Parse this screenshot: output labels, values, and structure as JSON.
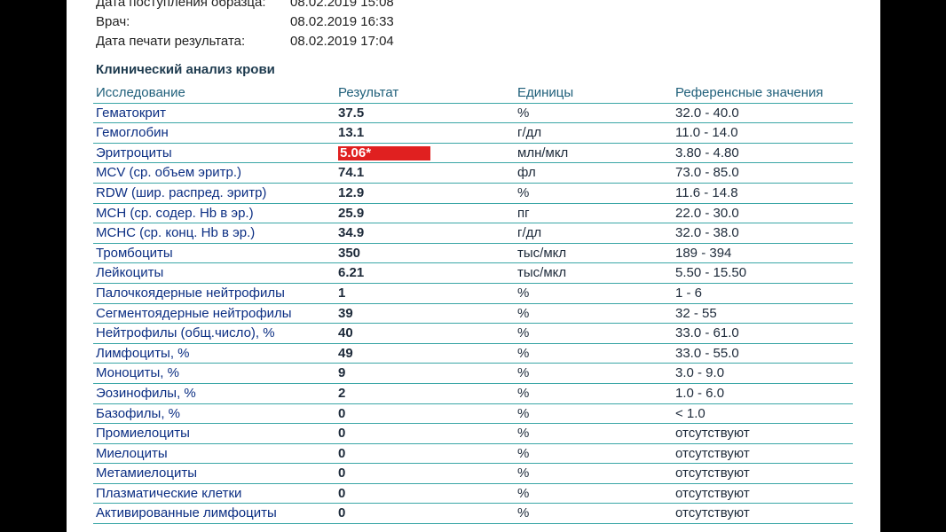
{
  "meta": {
    "rows": [
      {
        "label": "Дата поступления образца:",
        "value": "08.02.2019 15:08"
      },
      {
        "label": "Врач:",
        "value": "08.02.2019 16:33"
      },
      {
        "label": "Дата печати результата:",
        "value": "08.02.2019 17:04"
      }
    ]
  },
  "section_title": "Клинический анализ крови",
  "table": {
    "headers": {
      "name": "Исследование",
      "result": "Результат",
      "unit": "Единицы",
      "ref": "Референсные значения"
    },
    "rows": [
      {
        "name": "Гематокрит",
        "result": "37.5",
        "unit": "%",
        "ref": "32.0 - 40.0"
      },
      {
        "name": "Гемоглобин",
        "result": "13.1",
        "unit": "г/дл",
        "ref": "11.0 - 14.0"
      },
      {
        "name": "Эритроциты",
        "result": "5.06*",
        "unit": "млн/мкл",
        "ref": "3.80 - 4.80",
        "flag": true
      },
      {
        "name": "MCV (ср. объем эритр.)",
        "result": "74.1",
        "unit": "фл",
        "ref": "73.0 - 85.0"
      },
      {
        "name": "RDW (шир. распред. эритр)",
        "result": "12.9",
        "unit": "%",
        "ref": "11.6 - 14.8"
      },
      {
        "name": "MCH (ср. содер. Hb в эр.)",
        "result": "25.9",
        "unit": "пг",
        "ref": "22.0 - 30.0"
      },
      {
        "name": "MCHC (ср. конц. Hb в эр.)",
        "result": "34.9",
        "unit": "г/дл",
        "ref": "32.0 - 38.0"
      },
      {
        "name": "Тромбоциты",
        "result": "350",
        "unit": "тыс/мкл",
        "ref": "189 - 394"
      },
      {
        "name": "Лейкоциты",
        "result": "6.21",
        "unit": "тыс/мкл",
        "ref": "5.50 - 15.50"
      },
      {
        "name": "Палочкоядерные нейтрофилы",
        "result": "1",
        "unit": "%",
        "ref": "1 - 6"
      },
      {
        "name": "Сегментоядерные нейтрофилы",
        "result": "39",
        "unit": "%",
        "ref": "32 - 55"
      },
      {
        "name": "Нейтрофилы (общ.число), %",
        "result": "40",
        "unit": "%",
        "ref": "33.0 - 61.0"
      },
      {
        "name": "Лимфоциты, %",
        "result": "49",
        "unit": "%",
        "ref": "33.0 - 55.0"
      },
      {
        "name": "Моноциты, %",
        "result": "9",
        "unit": "%",
        "ref": "3.0 - 9.0"
      },
      {
        "name": "Эозинофилы, %",
        "result": "2",
        "unit": "%",
        "ref": "1.0 - 6.0"
      },
      {
        "name": "Базофилы, %",
        "result": "0",
        "unit": "%",
        "ref": "< 1.0"
      },
      {
        "name": "Промиелоциты",
        "result": "0",
        "unit": "%",
        "ref": "отсутствуют"
      },
      {
        "name": "Миелоциты",
        "result": "0",
        "unit": "%",
        "ref": "отсутствуют"
      },
      {
        "name": "Метамиелоциты",
        "result": "0",
        "unit": "%",
        "ref": "отсутствуют"
      },
      {
        "name": "Плазматические клетки",
        "result": "0",
        "unit": "%",
        "ref": "отсутствуют"
      },
      {
        "name": "Активированные лимфоциты",
        "result": "0",
        "unit": "%",
        "ref": "отсутствуют"
      }
    ]
  },
  "colors": {
    "flag_bg": "#e02020",
    "border": "#3aa6a6",
    "name_text": "#0b2e83"
  }
}
